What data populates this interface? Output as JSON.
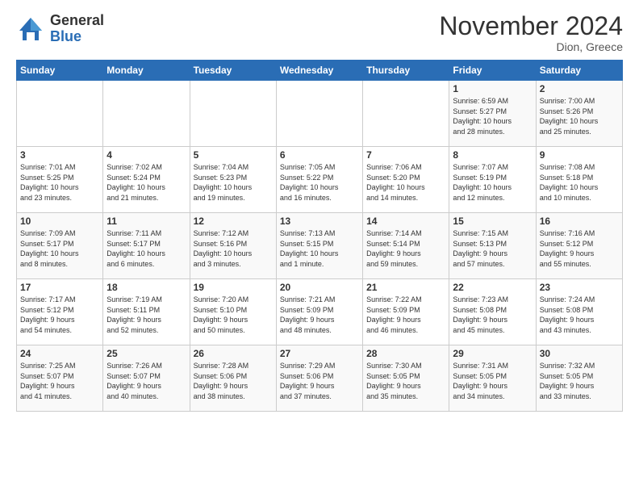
{
  "header": {
    "logo_general": "General",
    "logo_blue": "Blue",
    "month": "November 2024",
    "location": "Dion, Greece"
  },
  "weekdays": [
    "Sunday",
    "Monday",
    "Tuesday",
    "Wednesday",
    "Thursday",
    "Friday",
    "Saturday"
  ],
  "weeks": [
    [
      {
        "day": "",
        "info": ""
      },
      {
        "day": "",
        "info": ""
      },
      {
        "day": "",
        "info": ""
      },
      {
        "day": "",
        "info": ""
      },
      {
        "day": "",
        "info": ""
      },
      {
        "day": "1",
        "info": "Sunrise: 6:59 AM\nSunset: 5:27 PM\nDaylight: 10 hours\nand 28 minutes."
      },
      {
        "day": "2",
        "info": "Sunrise: 7:00 AM\nSunset: 5:26 PM\nDaylight: 10 hours\nand 25 minutes."
      }
    ],
    [
      {
        "day": "3",
        "info": "Sunrise: 7:01 AM\nSunset: 5:25 PM\nDaylight: 10 hours\nand 23 minutes."
      },
      {
        "day": "4",
        "info": "Sunrise: 7:02 AM\nSunset: 5:24 PM\nDaylight: 10 hours\nand 21 minutes."
      },
      {
        "day": "5",
        "info": "Sunrise: 7:04 AM\nSunset: 5:23 PM\nDaylight: 10 hours\nand 19 minutes."
      },
      {
        "day": "6",
        "info": "Sunrise: 7:05 AM\nSunset: 5:22 PM\nDaylight: 10 hours\nand 16 minutes."
      },
      {
        "day": "7",
        "info": "Sunrise: 7:06 AM\nSunset: 5:20 PM\nDaylight: 10 hours\nand 14 minutes."
      },
      {
        "day": "8",
        "info": "Sunrise: 7:07 AM\nSunset: 5:19 PM\nDaylight: 10 hours\nand 12 minutes."
      },
      {
        "day": "9",
        "info": "Sunrise: 7:08 AM\nSunset: 5:18 PM\nDaylight: 10 hours\nand 10 minutes."
      }
    ],
    [
      {
        "day": "10",
        "info": "Sunrise: 7:09 AM\nSunset: 5:17 PM\nDaylight: 10 hours\nand 8 minutes."
      },
      {
        "day": "11",
        "info": "Sunrise: 7:11 AM\nSunset: 5:17 PM\nDaylight: 10 hours\nand 6 minutes."
      },
      {
        "day": "12",
        "info": "Sunrise: 7:12 AM\nSunset: 5:16 PM\nDaylight: 10 hours\nand 3 minutes."
      },
      {
        "day": "13",
        "info": "Sunrise: 7:13 AM\nSunset: 5:15 PM\nDaylight: 10 hours\nand 1 minute."
      },
      {
        "day": "14",
        "info": "Sunrise: 7:14 AM\nSunset: 5:14 PM\nDaylight: 9 hours\nand 59 minutes."
      },
      {
        "day": "15",
        "info": "Sunrise: 7:15 AM\nSunset: 5:13 PM\nDaylight: 9 hours\nand 57 minutes."
      },
      {
        "day": "16",
        "info": "Sunrise: 7:16 AM\nSunset: 5:12 PM\nDaylight: 9 hours\nand 55 minutes."
      }
    ],
    [
      {
        "day": "17",
        "info": "Sunrise: 7:17 AM\nSunset: 5:12 PM\nDaylight: 9 hours\nand 54 minutes."
      },
      {
        "day": "18",
        "info": "Sunrise: 7:19 AM\nSunset: 5:11 PM\nDaylight: 9 hours\nand 52 minutes."
      },
      {
        "day": "19",
        "info": "Sunrise: 7:20 AM\nSunset: 5:10 PM\nDaylight: 9 hours\nand 50 minutes."
      },
      {
        "day": "20",
        "info": "Sunrise: 7:21 AM\nSunset: 5:09 PM\nDaylight: 9 hours\nand 48 minutes."
      },
      {
        "day": "21",
        "info": "Sunrise: 7:22 AM\nSunset: 5:09 PM\nDaylight: 9 hours\nand 46 minutes."
      },
      {
        "day": "22",
        "info": "Sunrise: 7:23 AM\nSunset: 5:08 PM\nDaylight: 9 hours\nand 45 minutes."
      },
      {
        "day": "23",
        "info": "Sunrise: 7:24 AM\nSunset: 5:08 PM\nDaylight: 9 hours\nand 43 minutes."
      }
    ],
    [
      {
        "day": "24",
        "info": "Sunrise: 7:25 AM\nSunset: 5:07 PM\nDaylight: 9 hours\nand 41 minutes."
      },
      {
        "day": "25",
        "info": "Sunrise: 7:26 AM\nSunset: 5:07 PM\nDaylight: 9 hours\nand 40 minutes."
      },
      {
        "day": "26",
        "info": "Sunrise: 7:28 AM\nSunset: 5:06 PM\nDaylight: 9 hours\nand 38 minutes."
      },
      {
        "day": "27",
        "info": "Sunrise: 7:29 AM\nSunset: 5:06 PM\nDaylight: 9 hours\nand 37 minutes."
      },
      {
        "day": "28",
        "info": "Sunrise: 7:30 AM\nSunset: 5:05 PM\nDaylight: 9 hours\nand 35 minutes."
      },
      {
        "day": "29",
        "info": "Sunrise: 7:31 AM\nSunset: 5:05 PM\nDaylight: 9 hours\nand 34 minutes."
      },
      {
        "day": "30",
        "info": "Sunrise: 7:32 AM\nSunset: 5:05 PM\nDaylight: 9 hours\nand 33 minutes."
      }
    ]
  ]
}
